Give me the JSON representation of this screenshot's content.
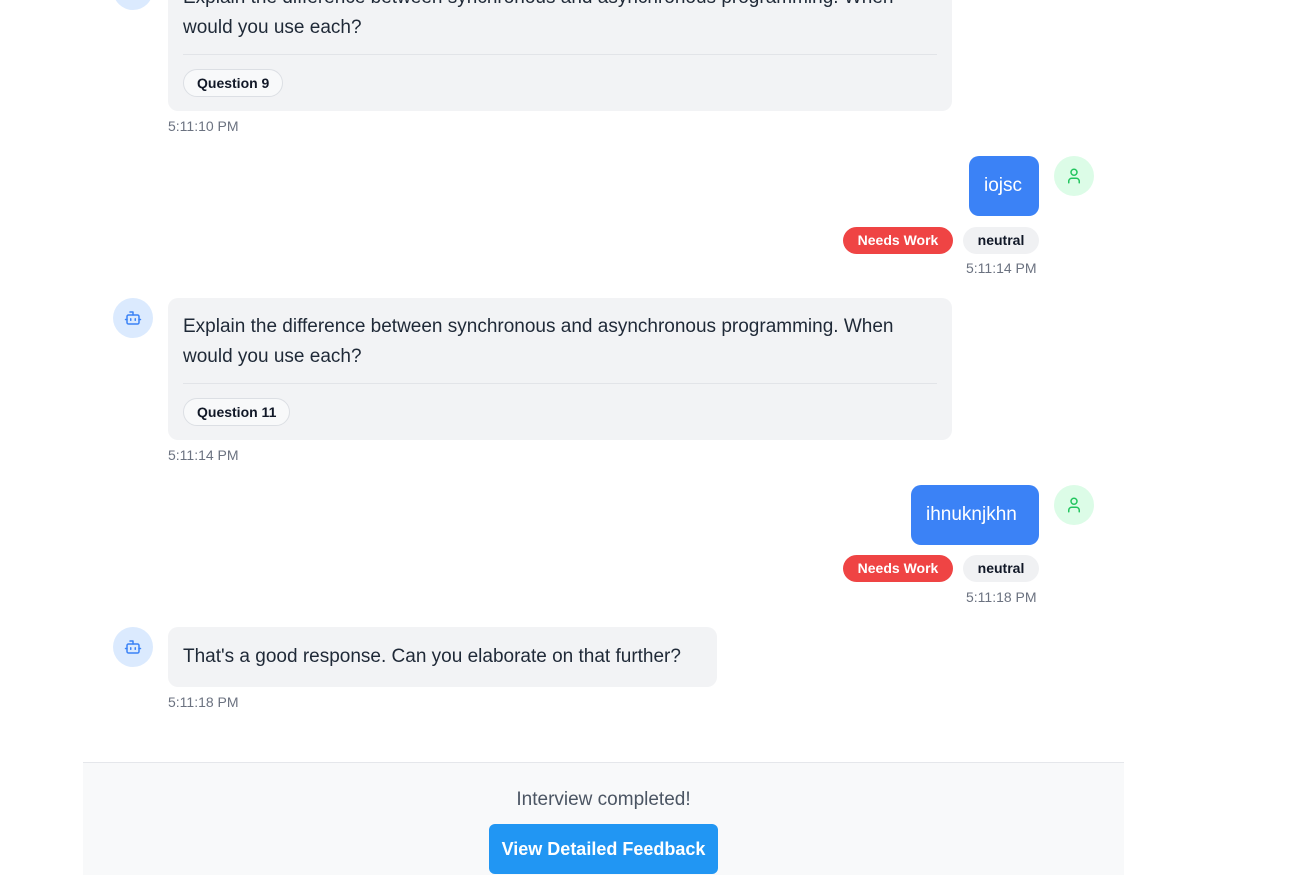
{
  "messages": [
    {
      "role": "bot",
      "text": "Explain the difference between synchronous and asynchronous programming. When would you use each?",
      "chip": "Question 9",
      "time": "5:11:10 PM"
    },
    {
      "role": "user",
      "text": "iojsc",
      "badges": [
        "Needs Work",
        "neutral"
      ],
      "time": "5:11:14 PM"
    },
    {
      "role": "bot",
      "text": "Explain the difference between synchronous and asynchronous programming. When would you use each?",
      "chip": "Question 11",
      "time": "5:11:14 PM"
    },
    {
      "role": "user",
      "text": "ihnuknjkhn",
      "badges": [
        "Needs Work",
        "neutral"
      ],
      "time": "5:11:18 PM"
    },
    {
      "role": "bot",
      "text": "That's a good response. Can you elaborate on that further?",
      "time": "5:11:18 PM"
    }
  ],
  "footer": {
    "status_text": "Interview completed!",
    "button_label": "View Detailed Feedback"
  },
  "icons": {
    "bot": "bot-icon",
    "user": "user-icon"
  },
  "colors": {
    "user_bubble": "#3b82f6",
    "needs_work_badge": "#ef4444",
    "primary_button": "#2196f3",
    "bot_avatar_bg": "#dbeafe",
    "user_avatar_bg": "#dcfce7"
  }
}
